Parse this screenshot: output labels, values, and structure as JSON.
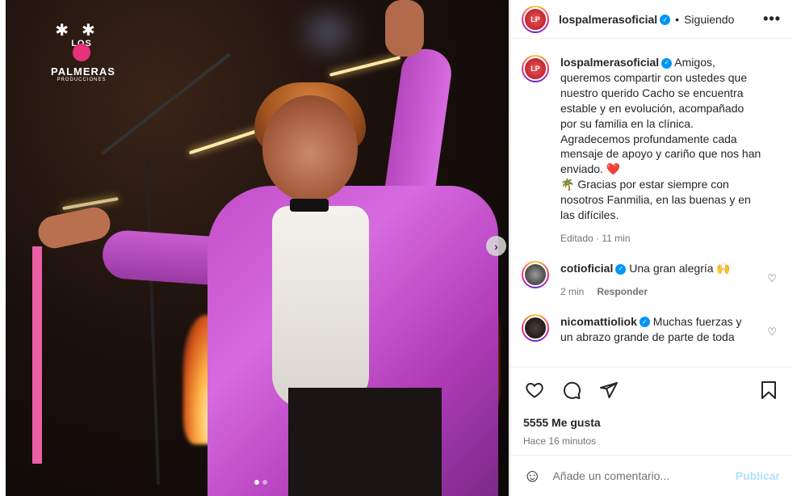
{
  "post": {
    "username": "lospalmerasoficial",
    "follow_status": "Siguiendo",
    "separator": "•",
    "more": "•••",
    "brand": {
      "line1": "LOS",
      "line2": "PALMERAS",
      "line3": "PRODUCCIONES"
    },
    "carousel": {
      "total_slides": 2,
      "active_slide": 1
    }
  },
  "caption": {
    "username": "lospalmerasoficial",
    "text": "Amigos, queremos compartir con ustedes que nuestro querido Cacho se encuentra estable y en evolución, acompañado por su familia en la clínica. Agradecemos profundamente cada mensaje de apoyo y cariño que nos han enviado.",
    "heart_emoji": "❤️",
    "line2_emoji": "🌴",
    "line2_text_a": "Gracias por estar siempre con nosotros",
    "line2_hashtag": "Fanmilia",
    "line2_text_b": ", en las buenas y en las difíciles.",
    "edited": "Editado · 11 min"
  },
  "comments": [
    {
      "username": "cotioficial",
      "text": "Una gran alegría 🙌",
      "time": "2 min",
      "reply_label": "Responder"
    },
    {
      "username": "nicomattioliok",
      "text": "Muchas fuerzas y un abrazo grande de parte de toda",
      "time": "",
      "reply_label": ""
    }
  ],
  "actions": {
    "likes": "5555 Me gusta",
    "time_ago": "Hace 16 minutos"
  },
  "add_comment": {
    "placeholder": "Añade un comentario...",
    "publish_label": "Publicar",
    "emoji_icon": "☺"
  },
  "colors": {
    "accent_pink": "#ec5fa6",
    "verified_blue": "#0095f6",
    "publish_disabled": "#b2dffc"
  }
}
